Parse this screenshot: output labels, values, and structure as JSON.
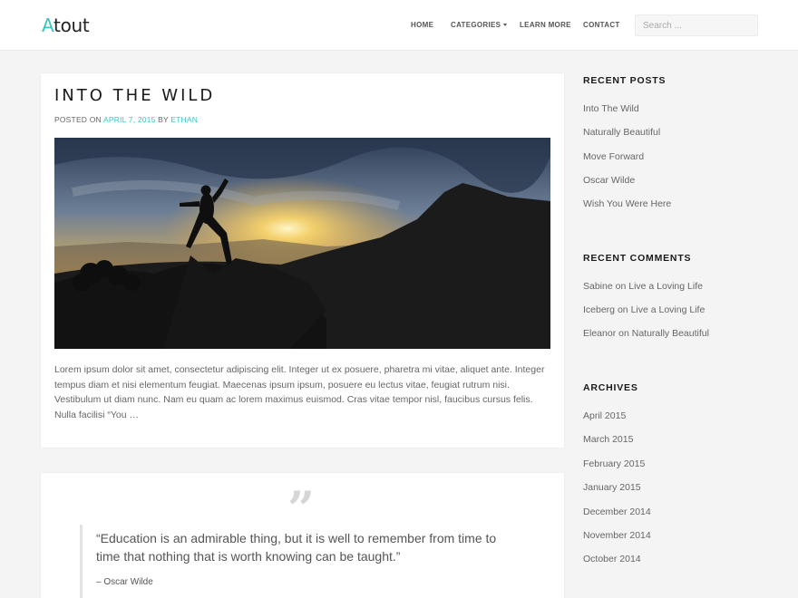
{
  "brand": {
    "logo_first": "A",
    "logo_rest": "tout",
    "accent_color": "#37c6c0"
  },
  "nav": {
    "home": "HOME",
    "categories": "CATEGORIES",
    "learn_more": "LEARN MORE",
    "contact": "CONTACT",
    "search_placeholder": "Search ..."
  },
  "post": {
    "title": "INTO THE WILD",
    "posted_on": "POSTED ON",
    "date": "APRIL 7, 2015",
    "by": "BY",
    "author": "ETHAN",
    "excerpt": "Lorem ipsum dolor sit amet, consectetur adipiscing elit. Integer ut ex posuere, pharetra mi vitae, aliquet ante. Integer tempus diam et nisi elementum feugiat. Maecenas ipsum ipsum, posuere eu lectus vitae, feugiat rutrum nisi. Vestibulum ut diam nunc. Nam eu quam ac lorem maximus euismod. Cras vitae tempor nisl, faucibus cursus felis. Nulla facilisi “You …"
  },
  "quote_post": {
    "icon": "quote-mark-icon",
    "text": "“Education is an admirable thing, but it is well to remember from time to time that nothing that is worth knowing can be taught.”",
    "cite": "– Oscar Wilde"
  },
  "sidebar": {
    "recent_posts_title": "RECENT POSTS",
    "recent_posts": [
      "Into The Wild",
      "Naturally Beautiful",
      "Move Forward",
      "Oscar Wilde",
      "Wish You Were Here"
    ],
    "recent_comments_title": "RECENT COMMENTS",
    "recent_comments": [
      {
        "author": "Sabine",
        "on": "on",
        "post": "Live a Loving Life"
      },
      {
        "author": "Iceberg",
        "on": "on",
        "post": "Live a Loving Life"
      },
      {
        "author": "Eleanor",
        "on": "on",
        "post": "Naturally Beautiful"
      }
    ],
    "archives_title": "ARCHIVES",
    "archives": [
      "April 2015",
      "March 2015",
      "February 2015",
      "January 2015",
      "December 2014",
      "November 2014",
      "October 2014"
    ]
  }
}
